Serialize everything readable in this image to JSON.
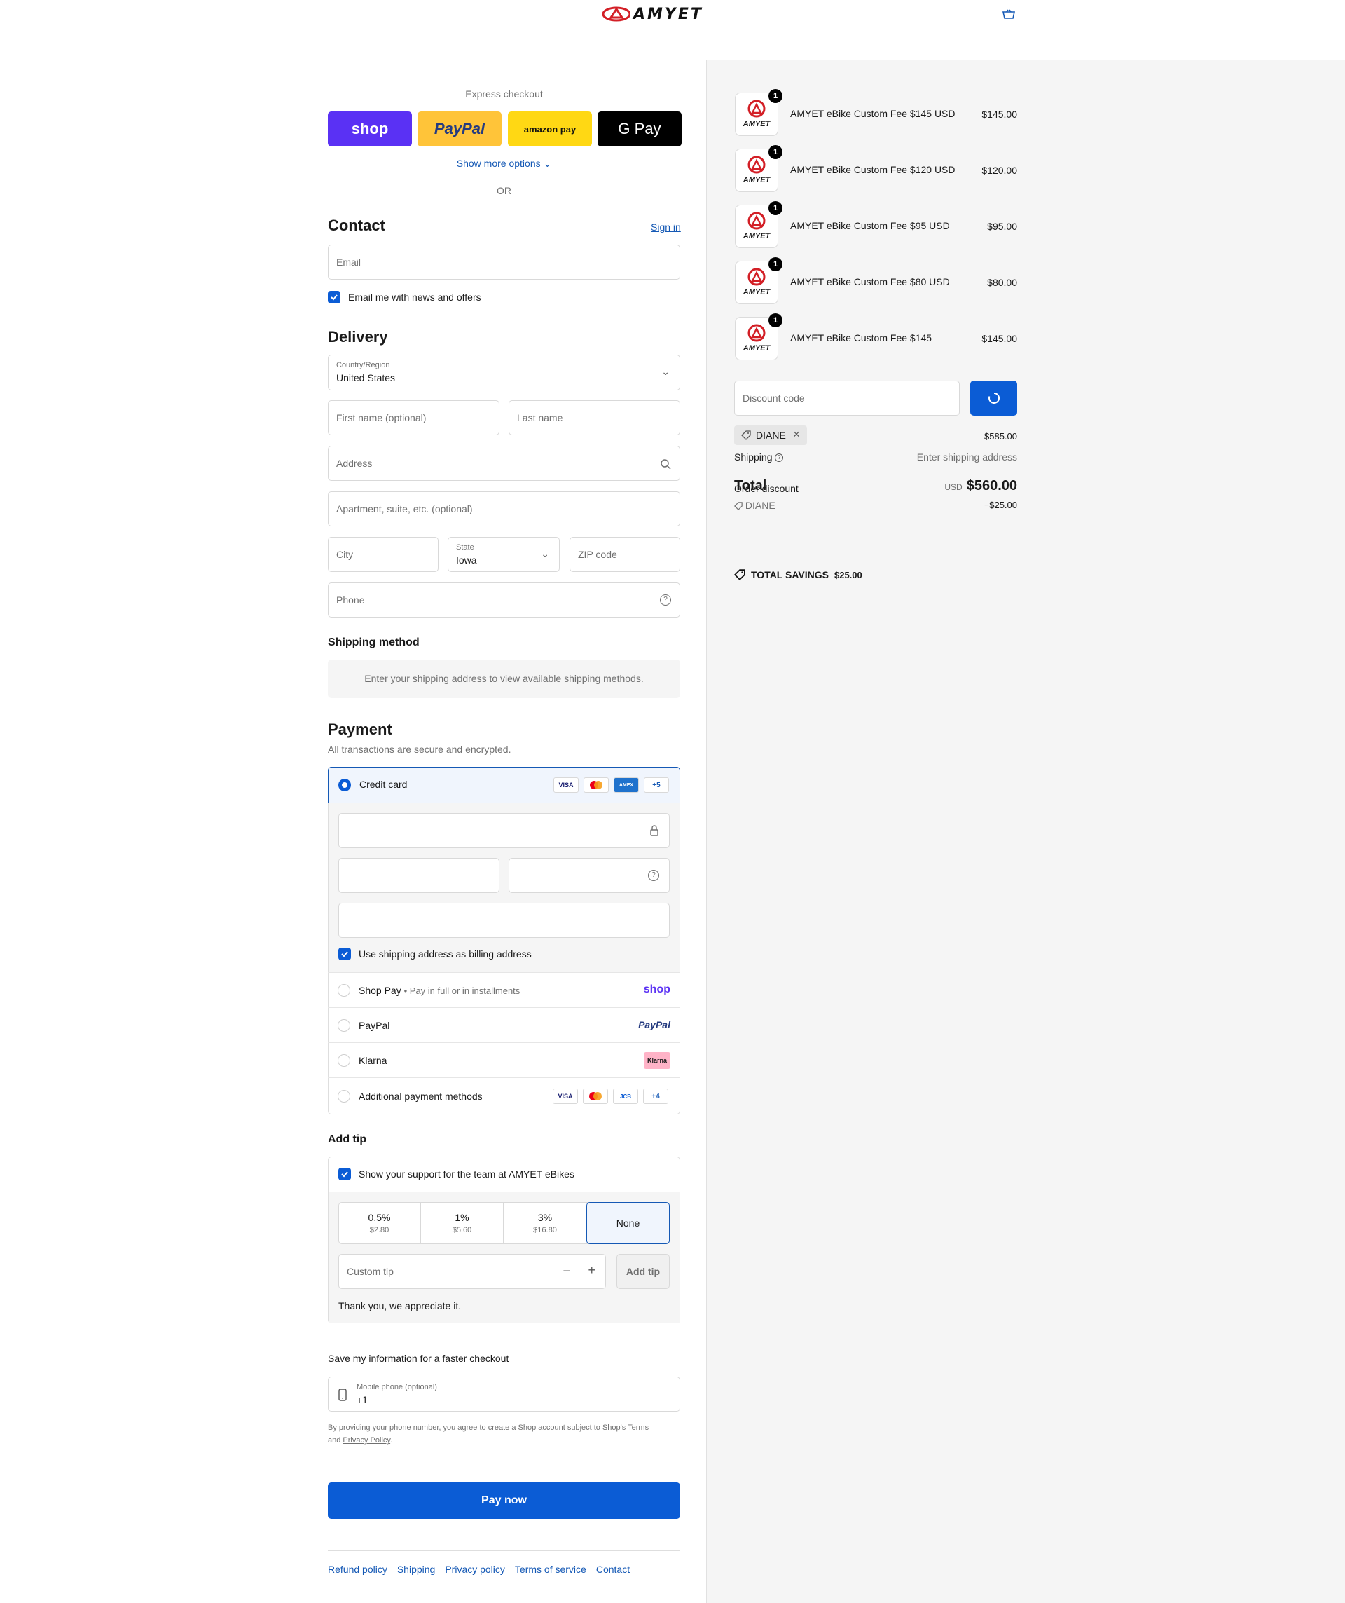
{
  "header": {
    "brand": "AMYET",
    "cart_icon": "cart-icon"
  },
  "express": {
    "title": "Express checkout",
    "buttons": [
      "shop",
      "PayPal",
      "amazon pay",
      "G Pay"
    ],
    "more": "Show more options",
    "or": "OR"
  },
  "contact": {
    "title": "Contact",
    "sign_in": "Sign in",
    "email_placeholder": "Email",
    "newsletter": "Email me with news and offers"
  },
  "delivery": {
    "title": "Delivery",
    "country_label": "Country/Region",
    "country_value": "United States",
    "first_name": "First name (optional)",
    "last_name": "Last name",
    "address": "Address",
    "apartment": "Apartment, suite, etc. (optional)",
    "city": "City",
    "state_label": "State",
    "state_value": "Iowa",
    "zip": "ZIP code",
    "phone": "Phone"
  },
  "shipping_method": {
    "title": "Shipping method",
    "message": "Enter your shipping address to view available shipping methods."
  },
  "payment": {
    "title": "Payment",
    "subtitle": "All transactions are secure and encrypted.",
    "credit_card": "Credit card",
    "cc_more": "+5",
    "billing_same": "Use shipping address as billing address",
    "shop_pay": "Shop Pay",
    "shop_pay_note": "Pay in full or in installments",
    "paypal": "PayPal",
    "klarna": "Klarna",
    "additional": "Additional payment methods",
    "additional_more": "+4",
    "badges": {
      "visa": "VISA",
      "amex": "AMEX",
      "jcb": "JCB",
      "klarna": "Klarna",
      "shop": "shop",
      "paypal": "PayPal"
    }
  },
  "tip": {
    "title": "Add tip",
    "support": "Show your support for the team at AMYET eBikes",
    "options": [
      {
        "pct": "0.5%",
        "amt": "$2.80"
      },
      {
        "pct": "1%",
        "amt": "$5.60"
      },
      {
        "pct": "3%",
        "amt": "$16.80"
      },
      {
        "pct": "None",
        "amt": ""
      }
    ],
    "custom": "Custom tip",
    "add_button": "Add tip",
    "thanks": "Thank you, we appreciate it."
  },
  "save_info": {
    "title": "Save my information for a faster checkout",
    "mobile_label": "Mobile phone (optional)",
    "mobile_value": "+1",
    "disclaimer_1": "By providing your phone number, you agree to create a Shop account subject to Shop's",
    "terms": "Terms",
    "and": "and",
    "privacy": "Privacy Policy",
    "period": "."
  },
  "pay_now": "Pay now",
  "footer_links": [
    "Refund policy",
    "Shipping",
    "Privacy policy",
    "Terms of service",
    "Contact"
  ],
  "order": {
    "items": [
      {
        "name": "AMYET eBike Custom Fee $145 USD",
        "price": "$145.00",
        "qty": "1"
      },
      {
        "name": "AMYET eBike Custom Fee $120 USD",
        "price": "$120.00",
        "qty": "1"
      },
      {
        "name": "AMYET eBike Custom Fee $95 USD",
        "price": "$95.00",
        "qty": "1"
      },
      {
        "name": "AMYET eBike Custom Fee $80 USD",
        "price": "$80.00",
        "qty": "1"
      },
      {
        "name": "AMYET eBike Custom Fee $145",
        "price": "$145.00",
        "qty": "1"
      }
    ],
    "thumb_brand": "AMYET",
    "discount_placeholder": "Discount code",
    "discount_tag": "DIANE",
    "subtotal_value": "$585.00",
    "shipping_label": "Shipping",
    "shipping_value": "Enter shipping address",
    "order_discount_label": "Order discount",
    "total_label": "Total",
    "currency": "USD",
    "total_value": "$560.00",
    "discount_code": "DIANE",
    "discount_value": "−$25.00",
    "savings_label": "TOTAL SAVINGS",
    "savings_value": "$25.00"
  },
  "colors": {
    "accent": "#0b5cd5",
    "shop": "#5a31f4",
    "paypal": "#ffc439",
    "amazon": "#ffd814",
    "gpay": "#000000"
  }
}
